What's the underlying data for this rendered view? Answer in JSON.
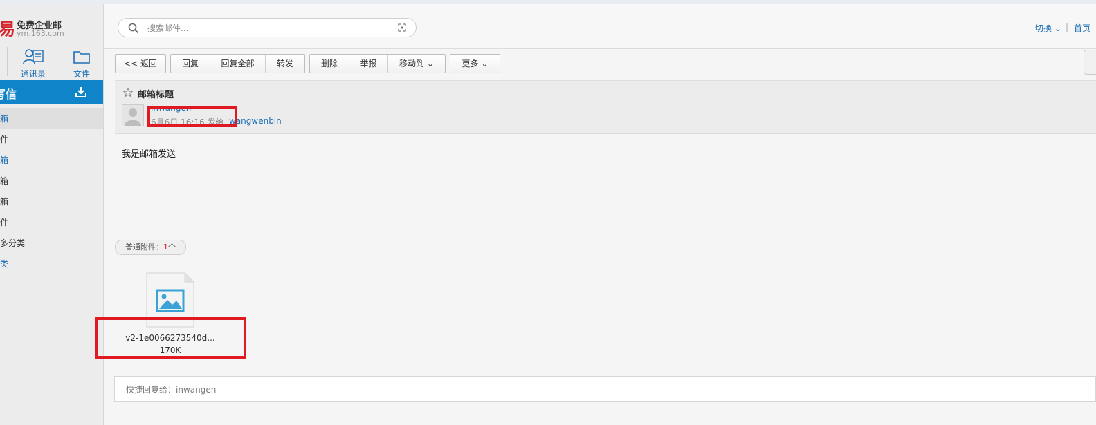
{
  "brand": {
    "logo_glyph": "易",
    "title": "免费企业邮",
    "subtitle": "ym.163.com"
  },
  "nav": {
    "contacts_label": "通讯录",
    "files_label": "文件"
  },
  "sidebar": {
    "compose_label": "写信",
    "folders": [
      {
        "label": "箱",
        "active": true
      },
      {
        "label": "件"
      },
      {
        "label": "箱",
        "blue": true
      },
      {
        "label": "箱"
      },
      {
        "label": "箱"
      },
      {
        "label": "件"
      },
      {
        "label": "多分类"
      },
      {
        "label": "类",
        "blue": true
      }
    ]
  },
  "search": {
    "placeholder": "搜索邮件..."
  },
  "header": {
    "switch_label": "切换",
    "separator": "|",
    "home_label": "首页"
  },
  "toolbar": {
    "back": "<< 返回",
    "reply": "回复",
    "reply_all": "回复全部",
    "forward": "转发",
    "delete": "删除",
    "report": "举报",
    "move_to": "移动到",
    "more": "更多"
  },
  "mail": {
    "subject": "邮箱标题",
    "sender": "inwangen",
    "time": "6月6日 16:16 发给",
    "recipient": "wangwenbin",
    "body": "我是邮箱发送"
  },
  "attachments": {
    "label_prefix": "普通附件：",
    "count": "1",
    "count_suffix": "个",
    "files": [
      {
        "name": "v2-1e0066273540d...",
        "size": "170K",
        "icon": "image-file-icon"
      }
    ]
  },
  "quick_reply": {
    "placeholder": "快捷回复给：inwangen"
  },
  "colors": {
    "accent_blue": "#0f84c8",
    "link_blue": "#1f6fb2",
    "highlight_red": "#e01a22"
  }
}
